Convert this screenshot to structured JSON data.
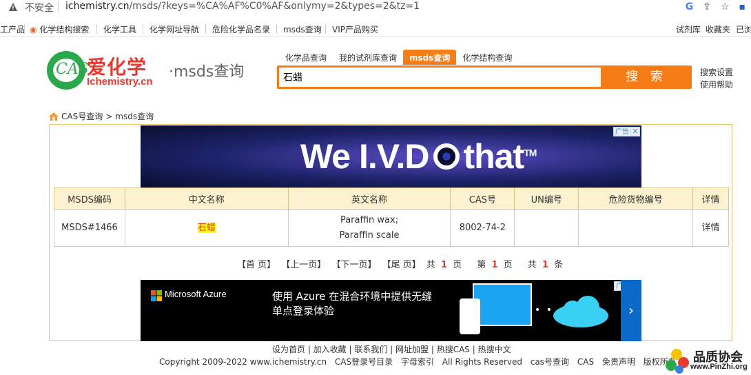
{
  "browser": {
    "insecure_label": "不安全",
    "url_host": "ichemistry.cn",
    "url_path": "/msds/?keys=%CA%AF%C0%AF&onlymy=2&types=2&tz=1"
  },
  "bookmarks": {
    "left": [
      "工产品",
      "化学结构搜索",
      "化学工具",
      "化学网址导航",
      "危险化学品名录",
      "msds查询",
      "VIP产品购买"
    ],
    "right": [
      "试剂库",
      "收藏夹",
      "已浏"
    ]
  },
  "header": {
    "logo_cn": "爱化学",
    "logo_en": "Ichemistry.cn",
    "logo_cas": "CAS",
    "logo_sub": "·msds查询",
    "tabs": [
      "化学品查询",
      "我的试剂库查询",
      "msds查询",
      "化学结构查询"
    ],
    "active_tab": 2,
    "search_value": "石蜡",
    "search_button": "搜 索",
    "search_settings": "搜索设置",
    "help": "使用帮助"
  },
  "breadcrumb": {
    "root": "CAS号查询",
    "sep": ">",
    "current": "msds查询"
  },
  "ad_top": {
    "text": "We I.V.D",
    "text_tail": "that",
    "tm": "TM",
    "tag": "广告",
    "close": "✕"
  },
  "table": {
    "headers": [
      "MSDS编码",
      "中文名称",
      "英文名称",
      "CAS号",
      "UN编号",
      "危险货物编号",
      "详情"
    ],
    "rows": [
      {
        "code": "MSDS#1466",
        "cn_name": "石蜡",
        "en_name_1": "Paraffin wax;",
        "en_name_2": "Paraffin scale",
        "cas": "8002-74-2",
        "un": "",
        "danger": "",
        "detail": "详情"
      }
    ]
  },
  "pager": {
    "first": "【首 页】",
    "prev": "【上一页】",
    "next": "【下一页】",
    "last": "【尾 页】",
    "total_pages_prefix": "共",
    "total_pages": "1",
    "total_pages_suffix": "页",
    "current_prefix": "第",
    "current": "1",
    "current_suffix": "页",
    "total_items_prefix": "共",
    "total_items": "1",
    "total_items_suffix": "条"
  },
  "ad_bottom": {
    "brand": "Microsoft Azure",
    "text": "使用 Azure 在混合环境中提供无缝单点登录体验",
    "tag": "广告",
    "arrow": "›"
  },
  "footer": {
    "links": "设为首页 | 加入收藏 | 联系我们 | 网址加盟 | 热搜CAS | 热搜中文",
    "copy_items": [
      "Copyright 2009-2022 www.ichemistry.cn",
      "CAS登录号目录",
      "字母索引",
      "All Rights Reserved",
      "cas号查询",
      "CAS",
      "免责声明",
      "版权所有"
    ]
  },
  "watermark": {
    "title": "品质协会",
    "url": "www.PinZhi.org"
  },
  "colors": {
    "accent_orange": "#f57c17",
    "logo_red": "#e8392f",
    "logo_green": "#2aa84a",
    "table_header_bg": "#fdf2cf"
  }
}
